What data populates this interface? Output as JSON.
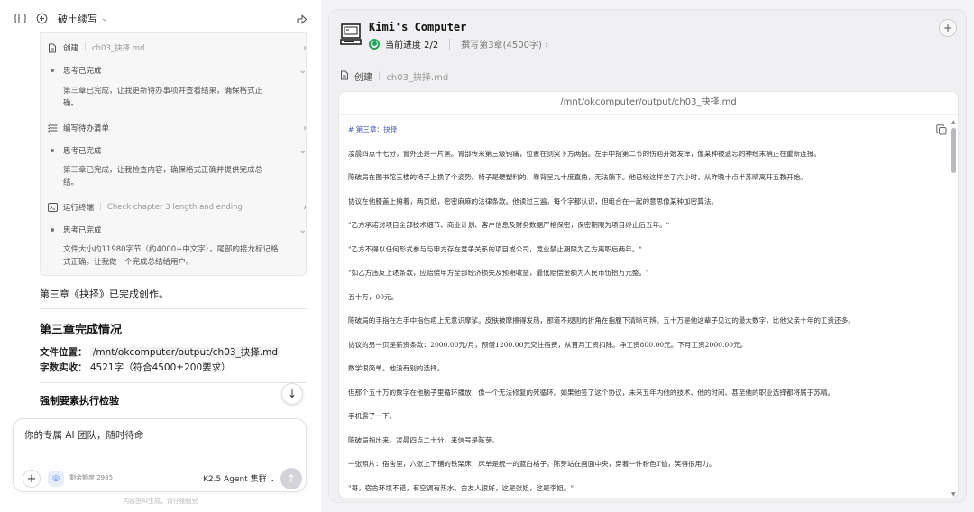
{
  "topbar": {
    "title": "破土续写"
  },
  "steps": [
    {
      "type": "file",
      "label": "创建",
      "meta": "ch03_抉择.md"
    },
    {
      "type": "think",
      "label": "思考已完成",
      "body": [
        "第三章已完成，让我更新待办事项并查看结果，确保格式正",
        "确。"
      ]
    },
    {
      "type": "todo",
      "label": "编写待办清单"
    },
    {
      "type": "think",
      "label": "思考已完成",
      "body": [
        "第三章已完成，让我检查内容，确保格式正确并提供完成总",
        "结。"
      ]
    },
    {
      "type": "terminal",
      "label": "运行终端",
      "meta": "Check chapter 3 length and ending"
    },
    {
      "type": "think",
      "label": "思考已完成",
      "body": [
        "文件大小约11980字节（约4000+中文字），尾部的接龙标记格",
        "式正确。让我做一个完成总结给用户。"
      ]
    }
  ],
  "summary": {
    "done_line": "第三章《抉择》已完成创作。",
    "heading": "第三章完成情况",
    "location_label": "文件位置",
    "location_value": "/mnt/okcomputer/output/ch03_抉择.md",
    "words_label": "字数实收",
    "words_value": "4521字（符合4500±200要求）",
    "sub_heading": "强制要素执行检验"
  },
  "composer": {
    "placeholder": "你的专属 AI 团队，随时待命",
    "quota": "剩余额度 2985",
    "agent": "K2.5 Agent 集群"
  },
  "disclaimer": "内容由AI生成，请仔细甄别",
  "panel": {
    "title": "Kimi's Computer",
    "progress_label": "当前进度 2/2",
    "progress_task": "撰写第3章(4500字)",
    "file_action": "创建",
    "file_name": "ch03_抉择.md",
    "path": "/mnt/okcomputer/output/ch03_抉择.md"
  },
  "document": [
    "# 第三章：抉择",
    "凌晨四点十七分，窗外还是一片黑。胃部传来第三级钝痛，位置在剑突下方两指。左手中指第二节的伤疤开始发痒，像某种被遗忘的神经末梢正在重新连接。",
    "陈破局在图书馆三楼的椅子上换了个姿势。椅子是硬塑料的，靠背呈九十度直角，无法躺下。他已经这样坐了六小时，从昨晚十点半苏晴离开五教开始。",
    "协议在他膝盖上摊着，两页纸，密密麻麻的法律条款。他读过三遍，每个字都认识，但组合在一起的意思像某种加密算法。",
    "\"乙方承诺对项目全部技术细节、商业计划、客户信息及财务数据严格保密，保密期限为项目终止后五年。\"",
    "\"乙方不得以任何形式参与与甲方存在竞争关系的项目或公司，竞业禁止期限为乙方离职后两年。\"",
    "\"如乙方违反上述条款，应赔偿甲方全部经济损失及预期收益，最低赔偿金额为人民币伍拾万元整。\"",
    "五十万，00元。",
    "陈破局的手指在左手中指伤疤上无意识摩挲。皮肤被摩擦得发热，那道不规则的折角在指腹下清晰可辨。五十万是他这辈子见过的最大数字，比他父亲十年的工资还多。",
    "协议的另一页是薪资条款：2000.00元/月，预借1200.00元交住宿费，从首月工资扣除。净工资800.00元。下月工资2000.00元。",
    "数学很简单。他没有别的选择。",
    "但那个五十万的数字在他脑子里循环播放，像一个无法修复的死循环。如果他签了这个协议，未来五年内他的技术、他的时间、甚至他的职业选择都将属于苏晴。",
    "手机震了一下。",
    "陈破局掏出来。凌晨四点二十分，来信号是陈芽。",
    "一张照片：宿舍里，六张上下铺的铁架床，床单是统一的蓝白格子。陈芽站在画面中央，穿着一件粉色T恤，笑得很用力。",
    "\"哥，宿舍环境不错，有空调有热水。舍友人很好，这是张姐，这是李姐。\""
  ]
}
